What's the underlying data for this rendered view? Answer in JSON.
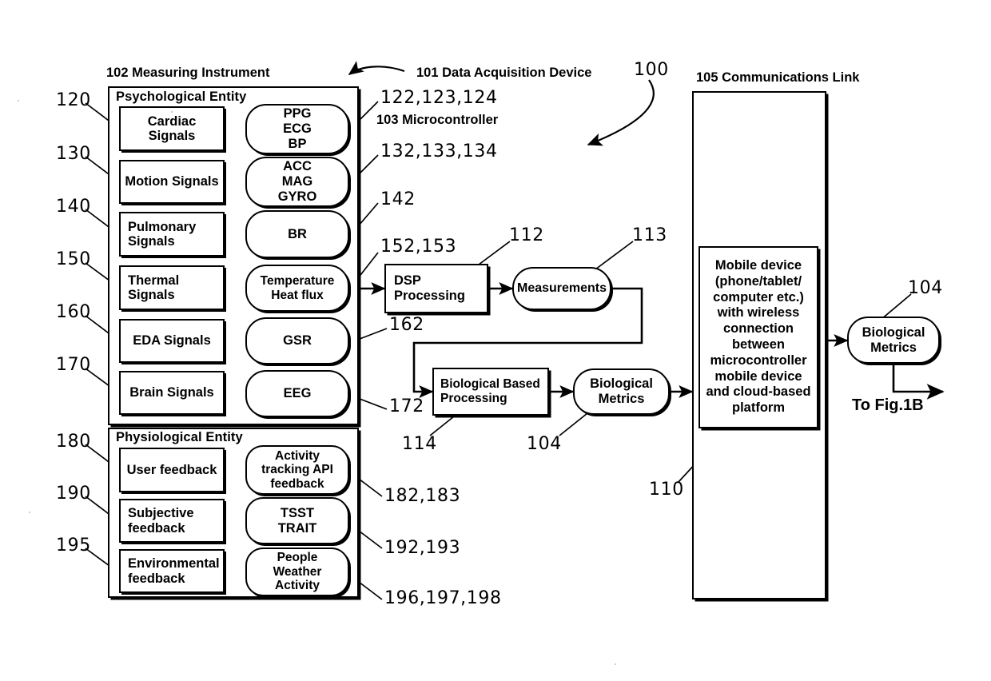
{
  "figure": {
    "title_refs": {
      "data_acquisition": "101 Data Acquisition Device",
      "measuring_instrument": "102 Measuring Instrument",
      "microcontroller": "103 Microcontroller",
      "communications_link": "105 Communications Link",
      "system": "100"
    },
    "to_fig": "To Fig.1B"
  },
  "measuring_instrument": {
    "psychological": {
      "title": "Psychological Entity",
      "rows": [
        {
          "ref": "120",
          "source": "Cardiac Signals",
          "target": "PPG\nECG\nBP",
          "target_ref": "122,123,124"
        },
        {
          "ref": "130",
          "source": "Motion Signals",
          "target": "ACC\nMAG\nGYRO",
          "target_ref": "132,133,134"
        },
        {
          "ref": "140",
          "source": "Pulmonary\nSignals",
          "target": "BR",
          "target_ref": "142"
        },
        {
          "ref": "150",
          "source": "Thermal\nSignals",
          "target": "Temperature\nHeat flux",
          "target_ref": "152,153"
        },
        {
          "ref": "160",
          "source": "EDA Signals",
          "target": "GSR",
          "target_ref": "162"
        },
        {
          "ref": "170",
          "source": "Brain Signals",
          "target": "EEG",
          "target_ref": "172"
        }
      ]
    },
    "physiological": {
      "title": "Physiological Entity",
      "rows": [
        {
          "ref": "180",
          "source": "User feedback",
          "target": "Activity\ntracking API\nfeedback",
          "target_ref": "182,183"
        },
        {
          "ref": "190",
          "source": "Subjective\nfeedback",
          "target": "TSST\nTRAIT",
          "target_ref": "192,193"
        },
        {
          "ref": "195",
          "source": "Environmental\nfeedback",
          "target": "People\nWeather\nActivity",
          "target_ref": "196,197,198"
        }
      ]
    }
  },
  "processing": {
    "dsp": {
      "label": "DSP\nProcessing",
      "ref": "112"
    },
    "measurements": {
      "label": "Measurements",
      "ref": "113"
    },
    "bio_processing": {
      "label": "Biological Based\nProcessing",
      "ref": "114"
    },
    "bio_metrics": {
      "label": "Biological\nMetrics",
      "ref": "104"
    }
  },
  "communications": {
    "link_ref": "105 Communications Link",
    "mobile_device": {
      "label": "Mobile device\n(phone/tablet/\ncomputer etc.)\nwith wireless\nconnection\nbetween\nmicrocontroller\nmobile device\nand cloud-based\nplatform",
      "ref": "110"
    },
    "bio_metrics_out": {
      "label": "Biological\nMetrics",
      "ref": "104"
    }
  }
}
